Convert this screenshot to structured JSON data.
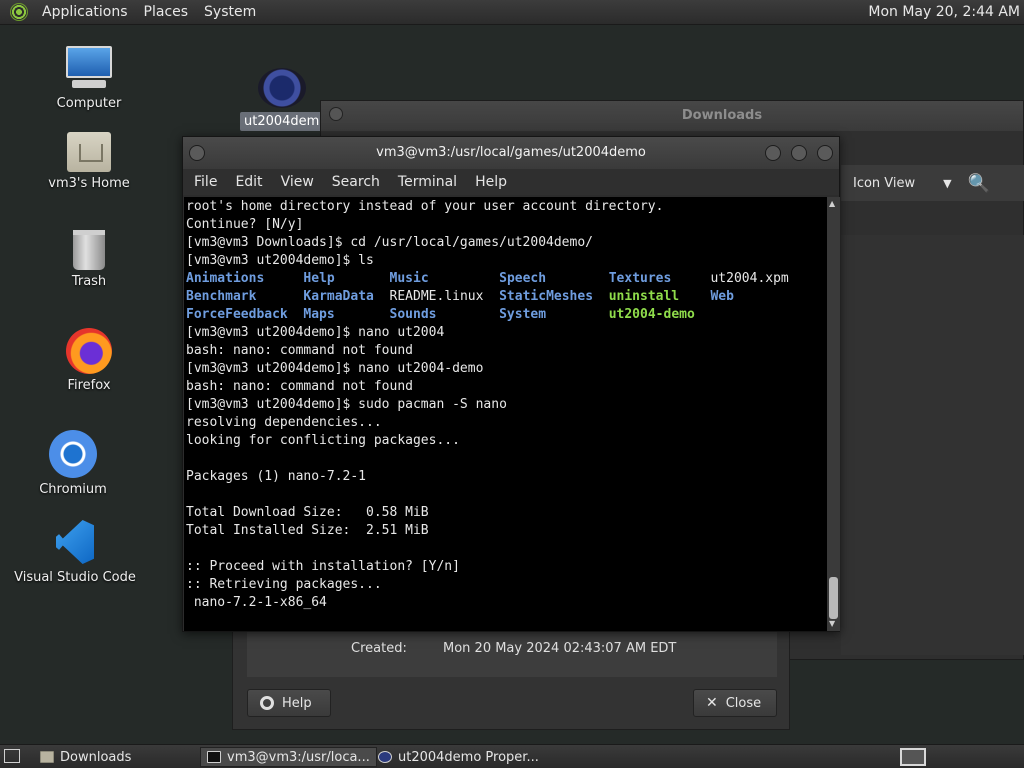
{
  "top_panel": {
    "menu": [
      "Applications",
      "Places",
      "System"
    ],
    "clock": "Mon May 20,  2:44 AM"
  },
  "desktop": {
    "icons": [
      {
        "label": "Computer",
        "icon": "computer-icon"
      },
      {
        "label": "vm3's Home",
        "icon": "home-folder-icon"
      },
      {
        "label": "Trash",
        "icon": "trash-icon"
      },
      {
        "label": "Firefox",
        "icon": "firefox-icon"
      },
      {
        "label": "Chromium",
        "icon": "chromium-icon"
      },
      {
        "label": "Visual Studio Code",
        "icon": "vscode-icon"
      }
    ],
    "ut_icon_label": "ut2004demo"
  },
  "downloads_window": {
    "title": "Downloads",
    "view_label": "Icon View",
    "dropdown_glyph": "▼",
    "search_glyph": "🔍"
  },
  "properties_dialog": {
    "created_label": "Created:",
    "created_value": "Mon 20 May 2024 02:43:07 AM EDT",
    "help_label": "Help",
    "close_label": "Close"
  },
  "terminal": {
    "title": "vm3@vm3:/usr/local/games/ut2004demo",
    "menu": [
      "File",
      "Edit",
      "View",
      "Search",
      "Terminal",
      "Help"
    ],
    "lines_before": [
      "root's home directory instead of your user account directory.",
      "Continue? [N/y]",
      "[vm3@vm3 Downloads]$ cd /usr/local/games/ut2004demo/",
      "[vm3@vm3 ut2004demo]$ ls"
    ],
    "ls_rows": [
      [
        {
          "text": "Animations",
          "kind": "dir"
        },
        {
          "text": "Help",
          "kind": "dir"
        },
        {
          "text": "Music",
          "kind": "dir"
        },
        {
          "text": "Speech",
          "kind": "dir"
        },
        {
          "text": "Textures",
          "kind": "dir"
        },
        {
          "text": "ut2004.xpm",
          "kind": "file"
        }
      ],
      [
        {
          "text": "Benchmark",
          "kind": "dir"
        },
        {
          "text": "KarmaData",
          "kind": "dir"
        },
        {
          "text": "README.linux",
          "kind": "file"
        },
        {
          "text": "StaticMeshes",
          "kind": "dir"
        },
        {
          "text": "uninstall",
          "kind": "exe"
        },
        {
          "text": "Web",
          "kind": "dir"
        }
      ],
      [
        {
          "text": "ForceFeedback",
          "kind": "dir"
        },
        {
          "text": "Maps",
          "kind": "dir"
        },
        {
          "text": "Sounds",
          "kind": "dir"
        },
        {
          "text": "System",
          "kind": "dir"
        },
        {
          "text": "ut2004-demo",
          "kind": "exe"
        },
        {
          "text": "",
          "kind": "file"
        }
      ]
    ],
    "lines_after": [
      "[vm3@vm3 ut2004demo]$ nano ut2004",
      "bash: nano: command not found",
      "[vm3@vm3 ut2004demo]$ nano ut2004-demo",
      "bash: nano: command not found",
      "[vm3@vm3 ut2004demo]$ sudo pacman -S nano",
      "resolving dependencies...",
      "looking for conflicting packages...",
      "",
      "Packages (1) nano-7.2-1",
      "",
      "Total Download Size:   0.58 MiB",
      "Total Installed Size:  2.51 MiB",
      "",
      ":: Proceed with installation? [Y/n]",
      ":: Retrieving packages...",
      " nano-7.2-1-x86_64"
    ]
  },
  "taskbar": {
    "tasks": [
      {
        "label": "Downloads",
        "icon": "folder-icon"
      },
      {
        "label": "vm3@vm3:/usr/loca...",
        "icon": "terminal-icon"
      },
      {
        "label": "ut2004demo Proper...",
        "icon": "ut2004-icon"
      }
    ]
  },
  "colors": {
    "desktop_bg": "#252a28",
    "ls_dir": "#6f9ddf",
    "ls_exe": "#8fdc4b"
  }
}
